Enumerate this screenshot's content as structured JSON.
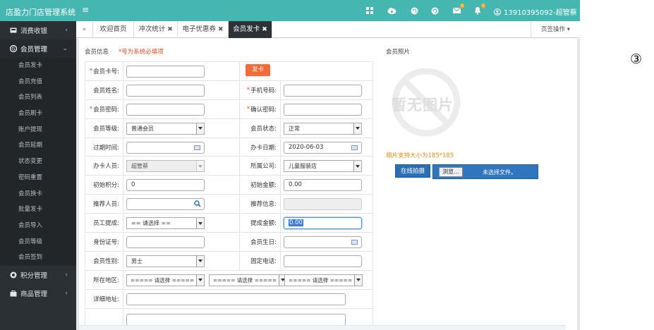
{
  "app": {
    "title": "店盈力门店管理系统",
    "menu_toggle": "≡"
  },
  "topbar": {
    "icons": [
      "grid-icon",
      "cloud-download-icon",
      "palette-icon",
      "refresh-icon",
      "mail-icon",
      "bell-icon"
    ],
    "mail_badge": "0",
    "bell_badge": "0",
    "user": "13910395092-超管蔡",
    "user_icon": "user-circle-icon",
    "color": "#45b6b0"
  },
  "sidebar": {
    "groups": [
      {
        "label": "消费收银",
        "icon": "cashier-icon",
        "chevron": "‹"
      },
      {
        "label": "会员管理",
        "icon": "member-icon",
        "chevron": "⌄"
      },
      {
        "label": "积分管理",
        "icon": "points-icon",
        "chevron": "‹"
      },
      {
        "label": "商品管理",
        "icon": "goods-icon",
        "chevron": "‹"
      }
    ],
    "member_items": [
      "会员发卡",
      "会员充值",
      "会员列表",
      "会员刷卡",
      "账户提现",
      "会员延期",
      "状态变更",
      "密码重置",
      "会员换卡",
      "批量发卡",
      "会员导入",
      "会员等级",
      "会员签到"
    ]
  },
  "tabs": {
    "nav": "«",
    "items": [
      {
        "label": "欢迎首页",
        "close": ""
      },
      {
        "label": "冲次统计",
        "close": "✖"
      },
      {
        "label": "电子优惠券",
        "close": "✖"
      },
      {
        "label": "会员发卡",
        "close": "✖"
      }
    ],
    "ops": "页签操作 ▾"
  },
  "form": {
    "section_title": "会员信息",
    "required_note": "*号为系统必填项",
    "issue_button": "发卡",
    "labels": {
      "card_no": "会员卡号:",
      "name": "会员姓名:",
      "phone": "手机号码:",
      "password": "会员密码:",
      "confirm_password": "确认密码:",
      "level": "会员等级:",
      "status": "会员状态:",
      "expire": "过期时间:",
      "issue_date": "办卡日期:",
      "staff": "办卡人员:",
      "company": "所属公司:",
      "init_points": "初始积分:",
      "init_amount": "初始金额:",
      "referrer": "推荐人员:",
      "referrer_info": "推荐信息:",
      "commission_staff": "员工提成:",
      "commission_amount": "提成金额:",
      "id_card": "身份证号:",
      "birthday": "会员生日:",
      "gender": "会员性别:",
      "telephone": "固定电话:",
      "region": "所在地区:",
      "address": "详细地址:"
    },
    "values": {
      "card_no": "",
      "name": "",
      "phone": "",
      "password": "",
      "confirm_password": "",
      "level": "普通会员",
      "status": "正常",
      "expire": "",
      "issue_date": "2020-06-03",
      "staff": "超管蔡",
      "company": "儿童服装店",
      "init_points": "0",
      "init_amount": "0.00",
      "referrer": "",
      "referrer_info": "",
      "commission_staff": "== 请选择 ==",
      "commission_amount": "0.00",
      "id_card": "",
      "birthday": "",
      "gender": "男士",
      "telephone": "",
      "province": "===== 请选择 =====",
      "city": "===== 请选择 =====",
      "district": "===== 请选择 =====",
      "address": ""
    }
  },
  "photo": {
    "title": "会员照片",
    "placeholder": "暂无图片",
    "size_note": "相片支持大小为185*185",
    "camera_button": "在线拍摄",
    "browse_button": "浏览...",
    "no_file": "未选择文件。"
  },
  "annotation": "③"
}
